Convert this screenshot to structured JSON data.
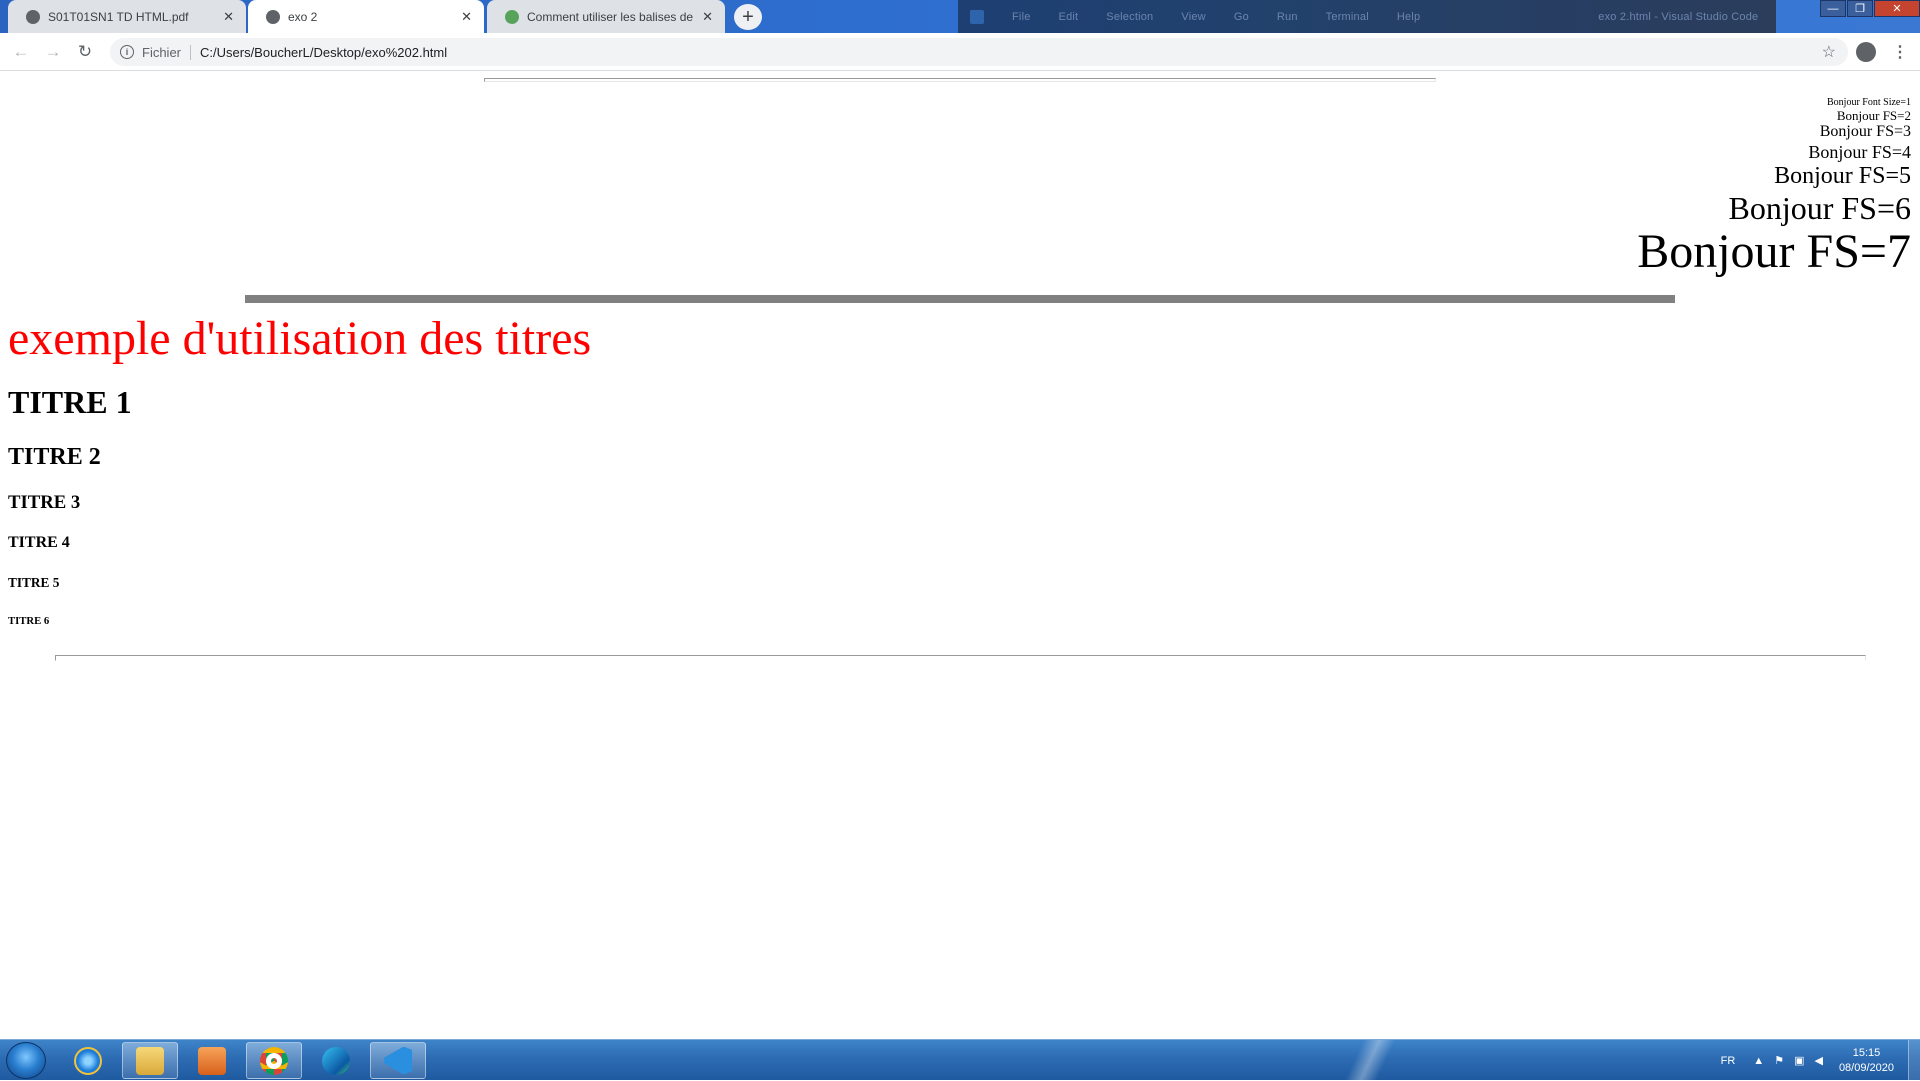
{
  "browser": {
    "tabs": [
      {
        "label": "S01T01SN1 TD HTML.pdf",
        "close": "✕"
      },
      {
        "label": "exo 2",
        "close": "✕"
      },
      {
        "label": "Comment utiliser les balises de c",
        "close": "✕"
      }
    ],
    "new_tab": "+",
    "address": {
      "scheme": "Fichier",
      "url": "C:/Users/BoucherL/Desktop/exo%202.html"
    },
    "back_glyph": "←",
    "forward_glyph": "→",
    "reload_glyph": "↻",
    "star_glyph": "☆",
    "menu_glyph": "⋮",
    "window_controls": {
      "minimize": "—",
      "maximize": "❐",
      "close": "✕"
    }
  },
  "background_window": {
    "menus": [
      "File",
      "Edit",
      "Selection",
      "View",
      "Go",
      "Run",
      "Terminal",
      "Help"
    ],
    "title": "exo 2.html - Visual Studio Code"
  },
  "page": {
    "font_size_lines": [
      "Bonjour Font Size=1",
      "Bonjour FS=2",
      "Bonjour FS=3",
      "Bonjour FS=4",
      "Bonjour FS=5",
      "Bonjour FS=6",
      "Bonjour FS=7"
    ],
    "red_heading": "exemple d'utilisation des titres",
    "red_color": "#ff0000",
    "headings": [
      "TITRE 1",
      "TITRE 2",
      "TITRE 3",
      "TITRE 4",
      "TITRE 5",
      "TITRE 6"
    ]
  },
  "taskbar": {
    "apps": [
      {
        "name": "internet-explorer-icon",
        "running": false
      },
      {
        "name": "file-explorer-icon",
        "running": true
      },
      {
        "name": "media-player-icon",
        "running": false
      },
      {
        "name": "chrome-icon",
        "running": true
      },
      {
        "name": "edge-icon",
        "running": false
      },
      {
        "name": "vscode-icon",
        "running": true
      }
    ],
    "tray": {
      "language": "FR",
      "time": "15:15",
      "date": "08/09/2020"
    }
  },
  "colors": {
    "titlebar": "#2f6fd0",
    "tab_inactive": "#dee1e6",
    "omnibox": "#f1f3f4",
    "rule": "#808080"
  }
}
